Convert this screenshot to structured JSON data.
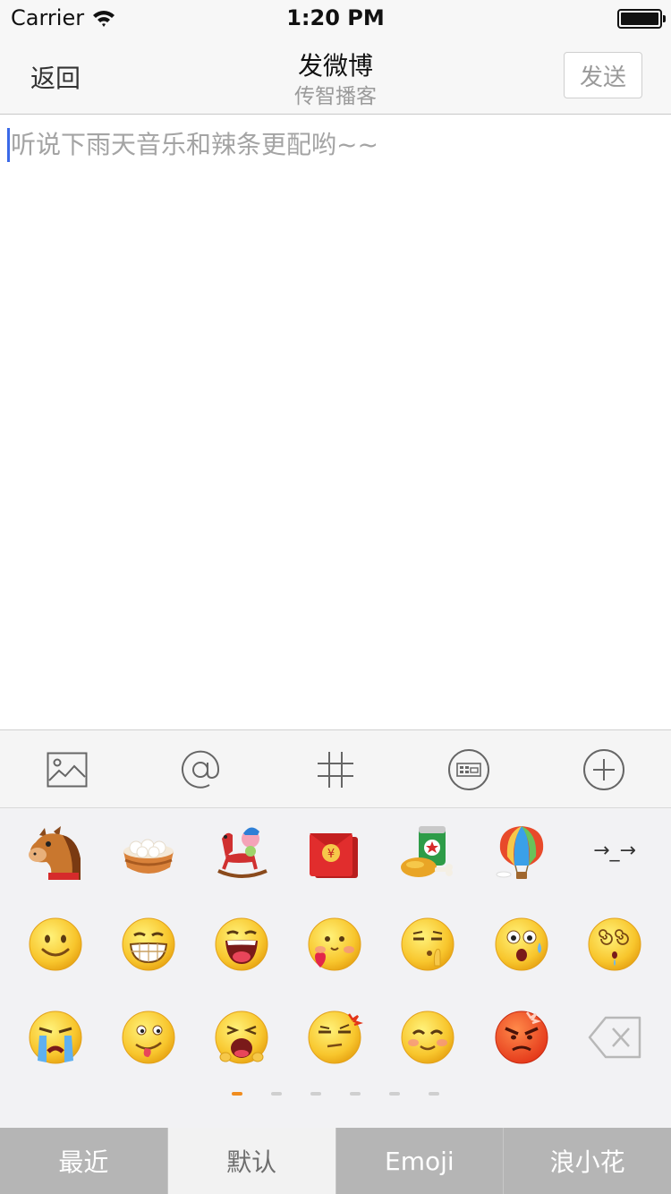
{
  "status_bar": {
    "carrier": "Carrier",
    "time": "1:20 PM"
  },
  "nav": {
    "back_label": "返回",
    "title": "发微博",
    "subtitle": "传智播客",
    "send_label": "发送"
  },
  "compose": {
    "placeholder": "听说下雨天音乐和辣条更配哟~~"
  },
  "toolbar": {
    "items": [
      "picture-icon",
      "mention-icon",
      "hashtag-icon",
      "emoticon-keyboard-icon",
      "add-icon"
    ]
  },
  "emoji_panel": {
    "rows": [
      [
        "horse-emoji",
        "rice-balls-emoji",
        "rocking-horse-emoji",
        "red-envelope-emoji",
        "beer-chicken-emoji",
        "hot-air-balloon-emoji",
        "arrow-face-emoji"
      ],
      [
        "smile-emoji",
        "grin-emoji",
        "laugh-emoji",
        "love-emoji",
        "shush-emoji",
        "sweat-shock-emoji",
        "dizzy-emoji"
      ],
      [
        "cry-emoji",
        "tongue-emoji",
        "yawn-emoji",
        "annoyed-emoji",
        "blush-emoji",
        "angry-emoji",
        "delete-key-icon"
      ]
    ],
    "text_emoticon": "→_→",
    "pages": 6,
    "current_page": 1
  },
  "tabs": [
    {
      "label": "最近",
      "selected": false
    },
    {
      "label": "默认",
      "selected": true
    },
    {
      "label": "Emoji",
      "selected": false
    },
    {
      "label": "浪小花",
      "selected": false
    }
  ],
  "colors": {
    "accent": "#f08c1e",
    "caret": "#3a69e8",
    "tab_bg": "#b5b5b5"
  }
}
